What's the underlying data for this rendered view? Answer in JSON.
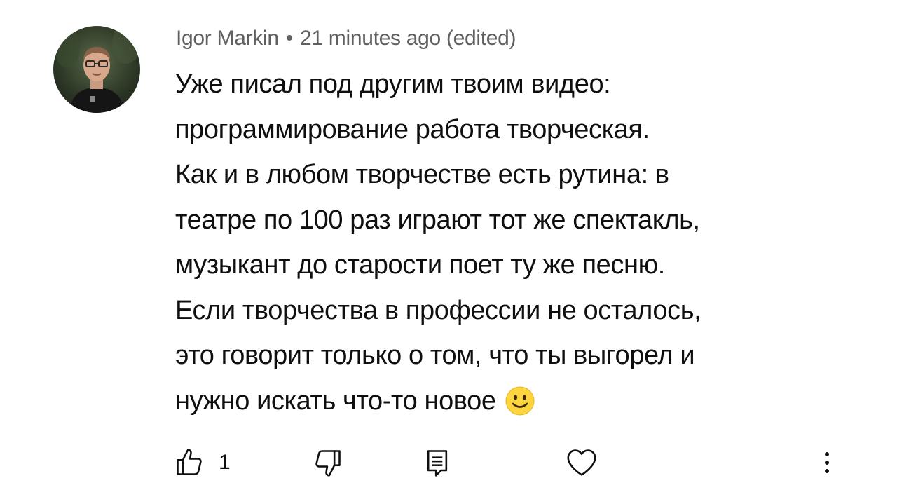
{
  "comment": {
    "author": "Igor Markin",
    "separator": "•",
    "time": "21 minutes ago (edited)",
    "lines": [
      "Уже писал под другим твоим видео:",
      "программирование работа творческая.",
      "Как и в любом творчестве есть рутина: в",
      "театре по 100 раз играют тот же спектакль,",
      "музыкант до старости поет ту же песню.",
      "Если творчества в профессии не осталось,",
      "это говорит только о том, что ты выгорел и",
      "нужно искать что-то новое"
    ],
    "emoji": "slightly-smiling-face-emoji"
  },
  "actions": {
    "like_icon": "thumbs-up-icon",
    "like_count": "1",
    "dislike_icon": "thumbs-down-icon",
    "reply_icon": "reply-comment-icon",
    "heart_icon": "heart-icon",
    "more_icon": "more-vertical-icon"
  },
  "colors": {
    "text": "#0f0f0f",
    "meta": "#606060",
    "emoji": "#fcd53f"
  }
}
